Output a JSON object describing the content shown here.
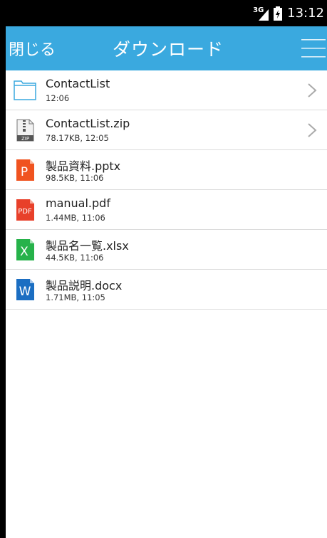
{
  "status_bar": {
    "network": "3G",
    "time": "13:12"
  },
  "header": {
    "close_label": "閉じる",
    "title": "ダウンロード"
  },
  "files": [
    {
      "name": "ContactList",
      "meta": "12:06",
      "type": "folder"
    },
    {
      "name": "ContactList.zip",
      "meta": "78.17KB, 12:05",
      "type": "zip",
      "zip_label": "ZIP"
    },
    {
      "name": "製品資料.pptx",
      "meta": "98.5KB, 11:06",
      "type": "pptx",
      "letter": "P"
    },
    {
      "name": "manual.pdf",
      "meta": "1.44MB, 11:06",
      "type": "pdf",
      "letter": "PDF"
    },
    {
      "name": "製品名一覧.xlsx",
      "meta": "44.5KB, 11:06",
      "type": "xlsx",
      "letter": "X"
    },
    {
      "name": "製品説明.docx",
      "meta": "1.71MB, 11:05",
      "type": "docx",
      "letter": "W"
    }
  ],
  "colors": {
    "header_bg": "#3aa9df",
    "pptx": "#f0531f",
    "pdf": "#e8402a",
    "xlsx": "#26b24a",
    "docx": "#1b6ec2",
    "folder": "#3aa9df"
  }
}
